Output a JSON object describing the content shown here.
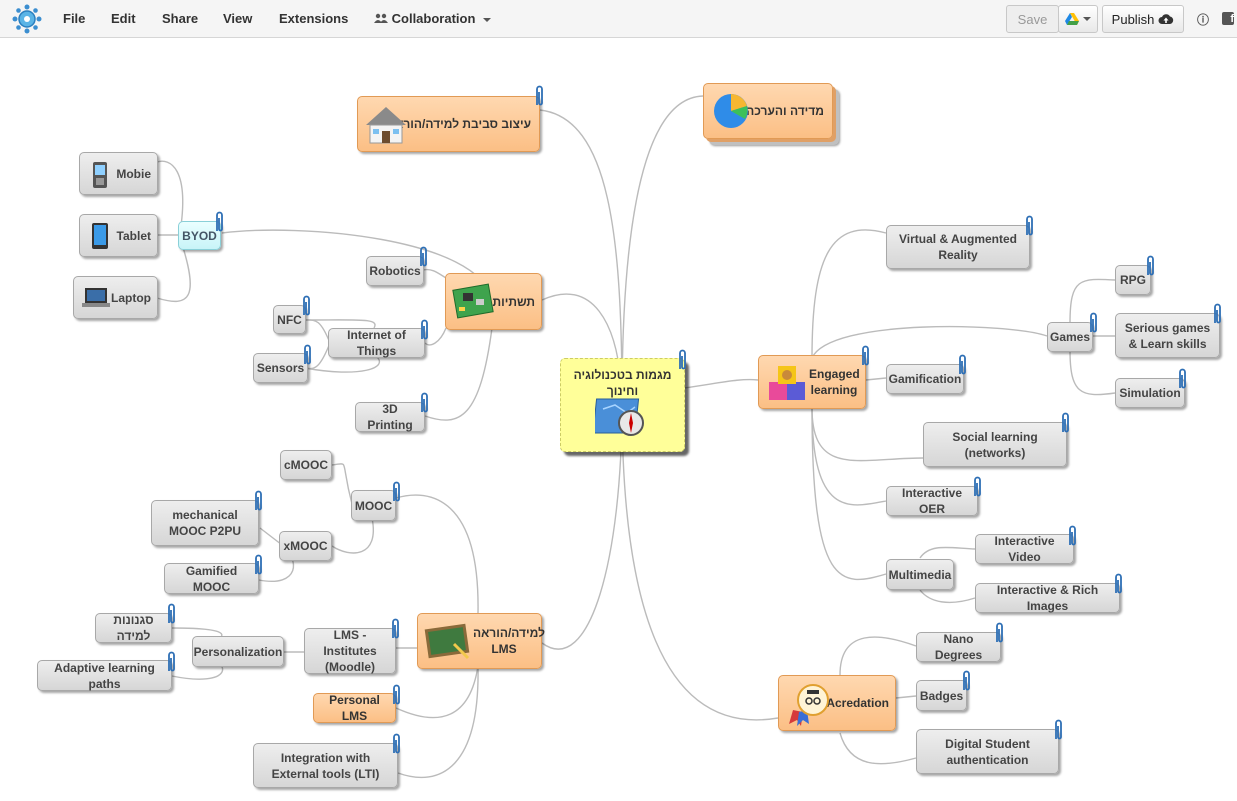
{
  "toolbar": {
    "menus": {
      "file": "File",
      "edit": "Edit",
      "share": "Share",
      "view": "View",
      "extensions": "Extensions",
      "collaboration": "Collaboration"
    },
    "save": "Save",
    "publish": "Publish"
  },
  "mindmap": {
    "central": "מגמות בטכנולוגיה וחינוך",
    "environment": "עיצוב סביבת למידה/הוראה",
    "assessment": "מדידה והערכה",
    "hardware": "תשתיות",
    "byod": "BYOD",
    "mobie": "Mobie",
    "tablet": "Tablet",
    "laptop": "Laptop",
    "robotics": "Robotics",
    "iot": "Internet of Things",
    "nfc": "NFC",
    "sensors": "Sensors",
    "printing": "3D Printing",
    "lms": "למידה/הוראה LMS",
    "mooc": "MOOC",
    "cmooc": "cMOOC",
    "xmooc": "xMOOC",
    "mechmooc": "mechanical MOOC P2PU",
    "gamifiedmooc": "Gamified MOOC",
    "lmsinst": "LMS - Institutes (Moodle)",
    "personalization": "Personalization",
    "styles": "סגנונות למידה",
    "adaptive": "Adaptive learning paths",
    "personallms": "Personal LMS",
    "lti": "Integration with External tools  (LTI)",
    "engaged": "Engaged learning",
    "vr": "Virtual & Augmented Reality",
    "games": "Games",
    "rpg": "RPG",
    "serious": "Serious games & Learn skills",
    "simulation": "Simulation",
    "gamification": "Gamification",
    "social": "Social learning (networks)",
    "oer": "Interactive OER",
    "multimedia": "Multimedia",
    "ivideo": "Interactive Video",
    "irich": "Interactive & Rich Images",
    "acredation": "Acredation",
    "nano": "Nano Degrees",
    "badges": "Badges",
    "digital": "Digital Student authentication"
  }
}
